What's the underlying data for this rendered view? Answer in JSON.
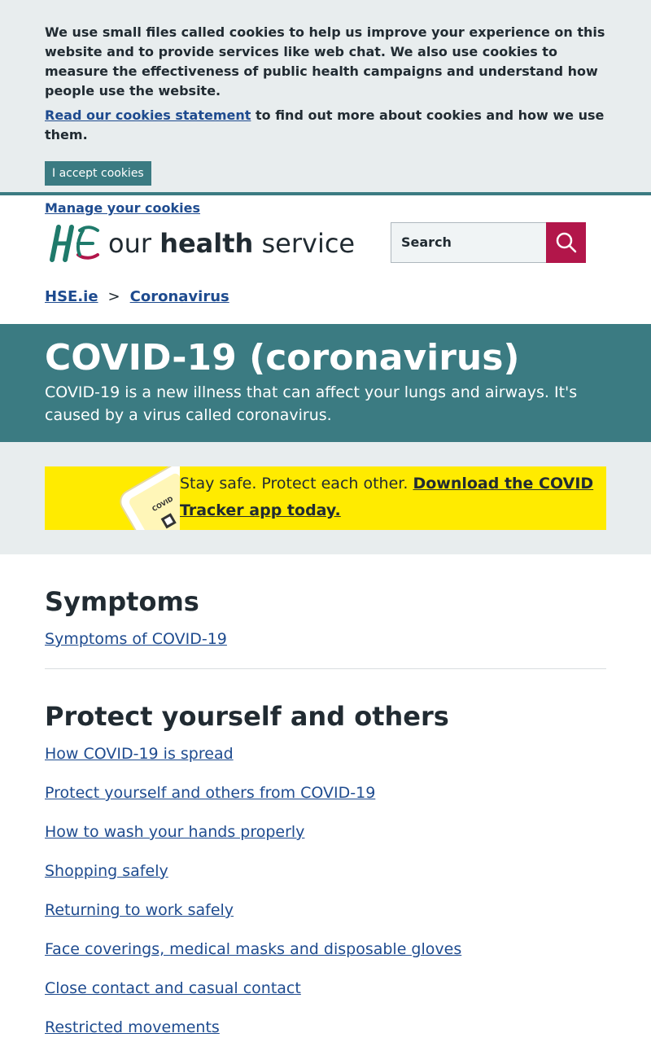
{
  "cookie": {
    "message": "We use small files called cookies to help us improve your experience on this website and to provide services like web chat. We also use cookies to measure the effectiveness of public health campaigns and understand how people use the website.",
    "statement_link": "Read our cookies statement",
    "statement_suffix": " to find out more about cookies and how we use them.",
    "accept_label": "I accept cookies",
    "manage_label": "Manage your cookies"
  },
  "header": {
    "brand_our": "our",
    "brand_health": "health",
    "brand_service": "service",
    "search_placeholder": "Search",
    "search_icon": "search-icon"
  },
  "breadcrumb": {
    "items": [
      "HSE.ie",
      "Coronavirus"
    ],
    "separator": ">"
  },
  "hero": {
    "title": "COVID-19 (coronavirus)",
    "description": "COVID-19 is a new illness that can affect your lungs and airways. It's caused by a virus called coronavirus."
  },
  "promo": {
    "text": "Stay safe. Protect each other. ",
    "link": "Download the COVID Tracker app today.",
    "phone_screen_text": "COVID TRACKER"
  },
  "sections": [
    {
      "heading": "Symptoms",
      "links": [
        "Symptoms of COVID-19"
      ]
    },
    {
      "heading": "Protect yourself and others",
      "links": [
        "How COVID-19 is spread",
        "Protect yourself and others from COVID-19",
        "How to wash your hands properly",
        "Shopping safely",
        "Returning to work safely",
        "Face coverings, medical masks and disposable gloves",
        "Close contact and casual contact",
        "Restricted movements"
      ]
    }
  ],
  "colors": {
    "teal": "#3b7b82",
    "link": "#1e4b8f",
    "search_button": "#b2164a",
    "promo_yellow": "#ffeb00",
    "panel_grey": "#e8edee"
  }
}
